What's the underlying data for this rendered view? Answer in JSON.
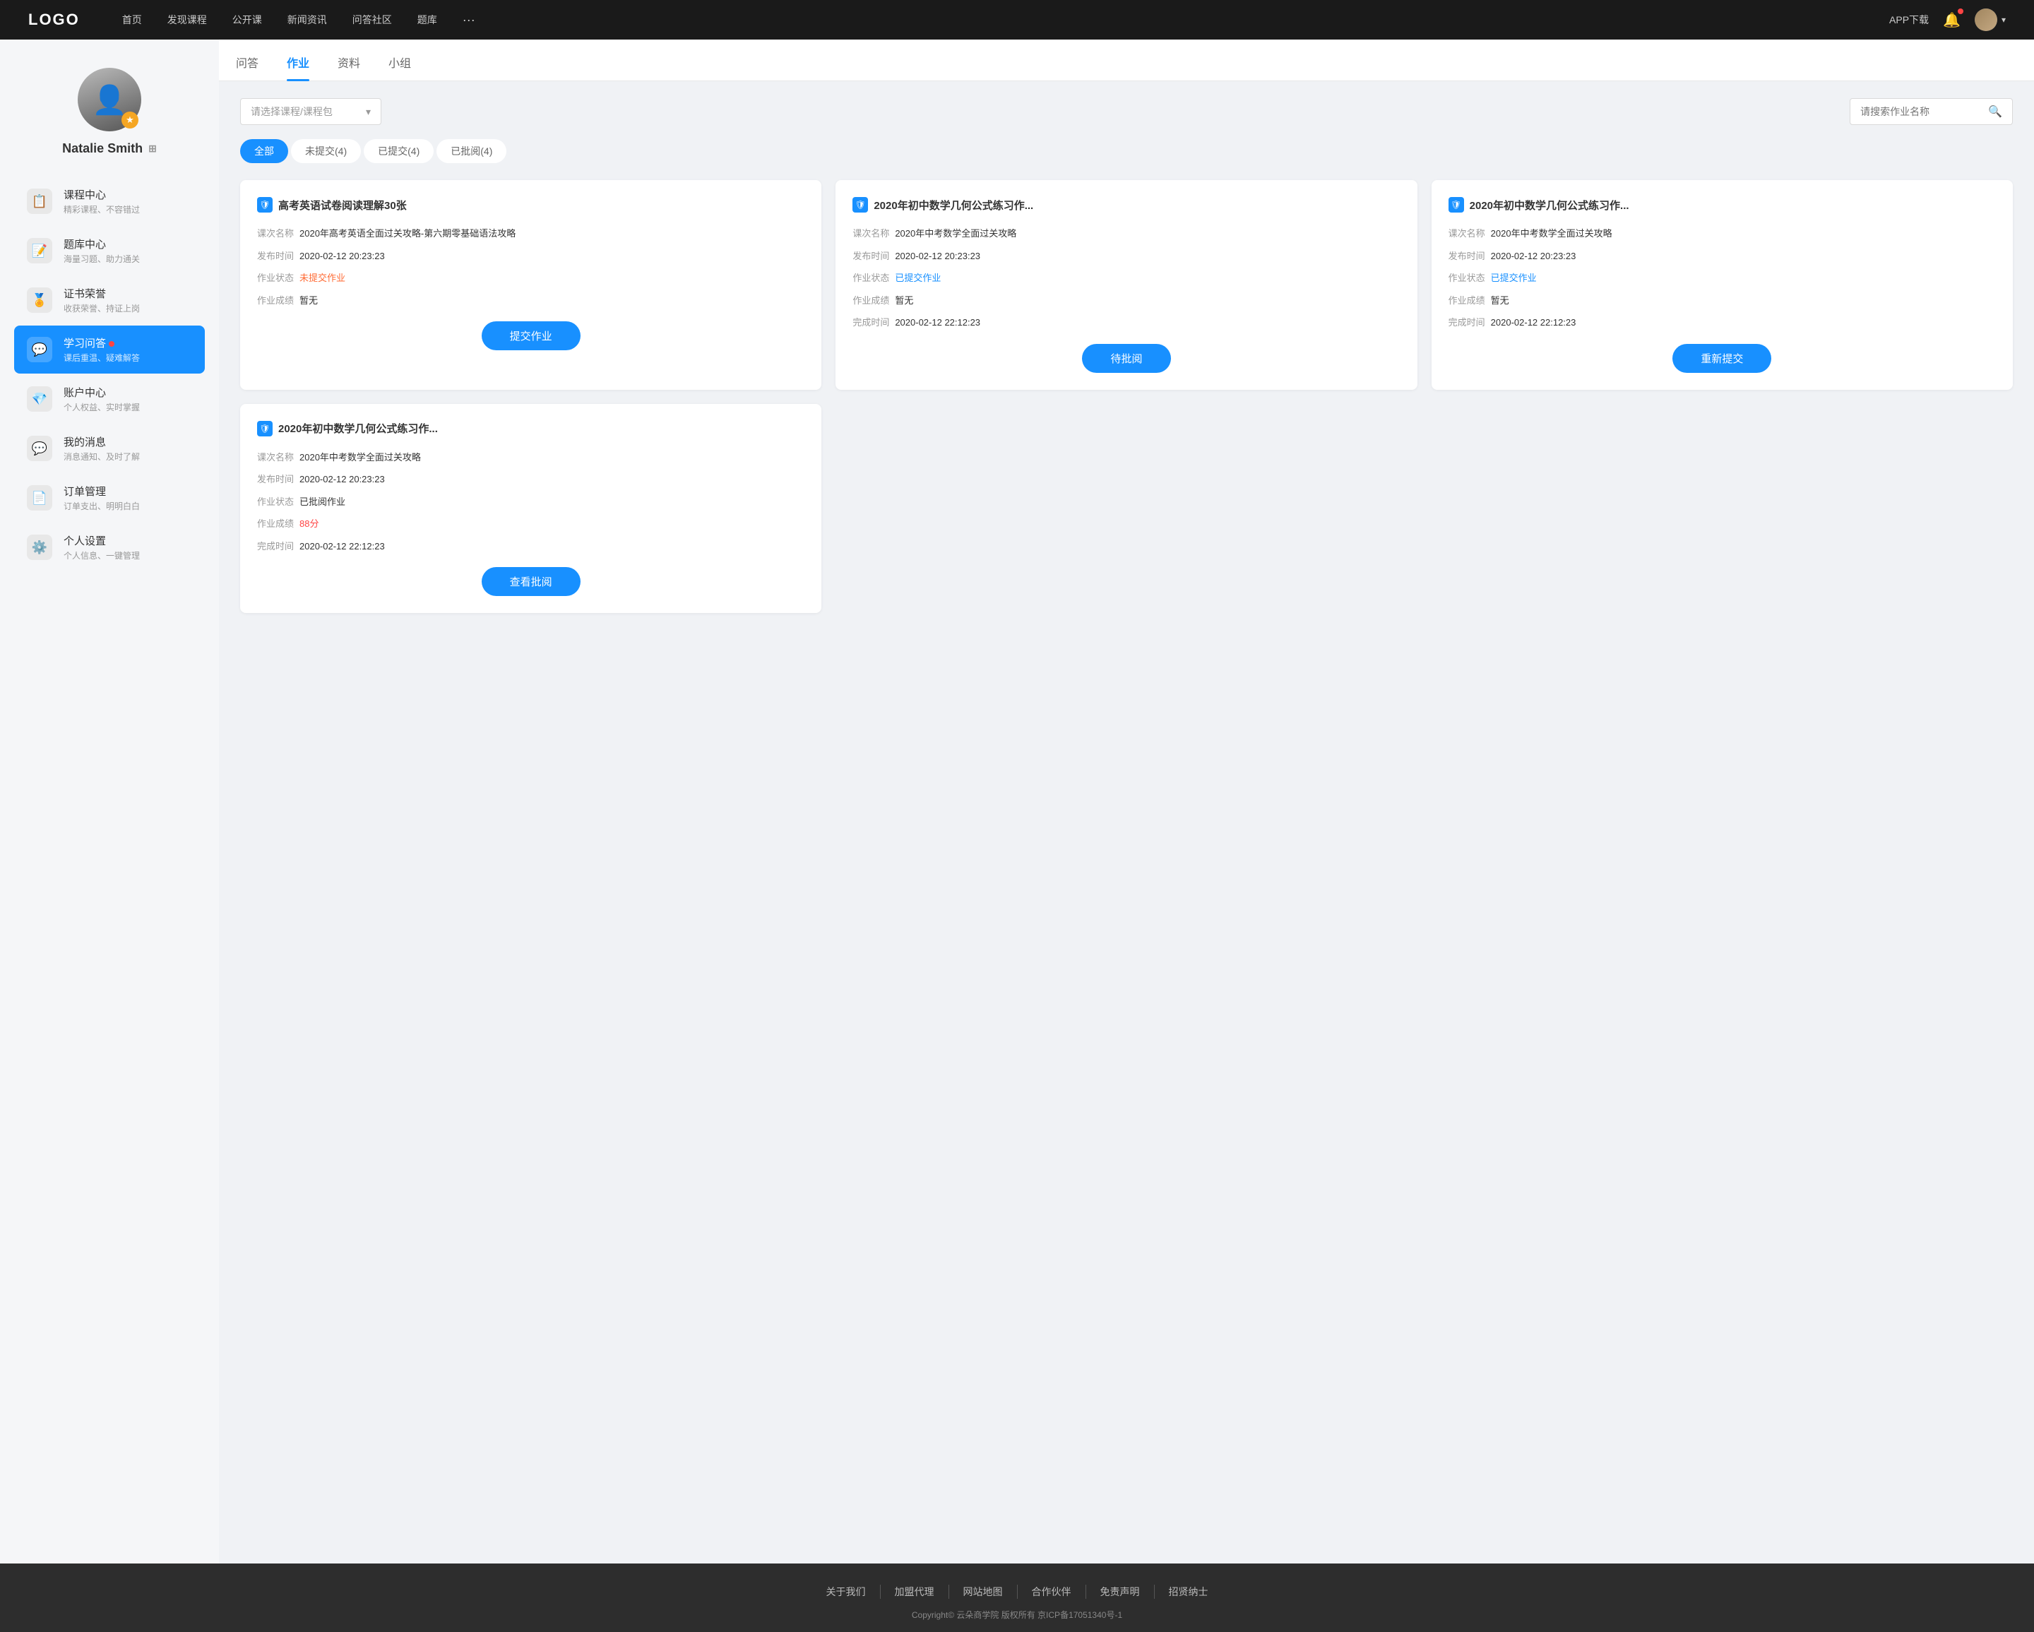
{
  "nav": {
    "logo": "LOGO",
    "links": [
      "首页",
      "发现课程",
      "公开课",
      "新闻资讯",
      "问答社区",
      "题库"
    ],
    "more": "···",
    "download": "APP下载"
  },
  "sidebar": {
    "username": "Natalie Smith",
    "items": [
      {
        "id": "course-center",
        "label": "课程中心",
        "sub": "精彩课程、不容错过",
        "icon": "📋",
        "active": false
      },
      {
        "id": "question-bank",
        "label": "题库中心",
        "sub": "海量习题、助力通关",
        "icon": "📝",
        "active": false
      },
      {
        "id": "certificate",
        "label": "证书荣誉",
        "sub": "收获荣誉、持证上岗",
        "icon": "🏅",
        "active": false
      },
      {
        "id": "study-qa",
        "label": "学习问答",
        "sub": "课后重温、疑难解答",
        "icon": "💬",
        "active": true,
        "badge": true
      },
      {
        "id": "account",
        "label": "账户中心",
        "sub": "个人权益、实时掌握",
        "icon": "💎",
        "active": false
      },
      {
        "id": "messages",
        "label": "我的消息",
        "sub": "消息通知、及时了解",
        "icon": "💬",
        "active": false
      },
      {
        "id": "orders",
        "label": "订单管理",
        "sub": "订单支出、明明白白",
        "icon": "📄",
        "active": false
      },
      {
        "id": "settings",
        "label": "个人设置",
        "sub": "个人信息、一键管理",
        "icon": "⚙️",
        "active": false
      }
    ]
  },
  "tabs": [
    "问答",
    "作业",
    "资料",
    "小组"
  ],
  "active_tab": "作业",
  "filter": {
    "course_placeholder": "请选择课程/课程包",
    "search_placeholder": "请搜索作业名称"
  },
  "status_buttons": [
    "全部",
    "未提交(4)",
    "已提交(4)",
    "已批阅(4)"
  ],
  "active_status": "全部",
  "cards": [
    {
      "title": "高考英语试卷阅读理解30张",
      "course_name": "2020年高考英语全面过关攻略-第六期零基础语法攻略",
      "publish_time": "2020-02-12 20:23:23",
      "status_label": "未提交作业",
      "status_type": "unsubmitted",
      "score": "暂无",
      "finish_time": "",
      "btn_label": "提交作业",
      "show_finish": false
    },
    {
      "title": "2020年初中数学几何公式练习作...",
      "course_name": "2020年中考数学全面过关攻略",
      "publish_time": "2020-02-12 20:23:23",
      "status_label": "已提交作业",
      "status_type": "submitted",
      "score": "暂无",
      "finish_time": "2020-02-12 22:12:23",
      "btn_label": "待批阅",
      "show_finish": true
    },
    {
      "title": "2020年初中数学几何公式练习作...",
      "course_name": "2020年中考数学全面过关攻略",
      "publish_time": "2020-02-12 20:23:23",
      "status_label": "已提交作业",
      "status_type": "submitted",
      "score": "暂无",
      "finish_time": "2020-02-12 22:12:23",
      "btn_label": "重新提交",
      "show_finish": true
    },
    {
      "title": "2020年初中数学几何公式练习作...",
      "course_name": "2020年中考数学全面过关攻略",
      "publish_time": "2020-02-12 20:23:23",
      "status_label": "已批阅作业",
      "status_type": "reviewed",
      "score": "88分",
      "score_type": "red",
      "finish_time": "2020-02-12 22:12:23",
      "btn_label": "查看批阅",
      "show_finish": true
    }
  ],
  "card_labels": {
    "course_name": "课次名称",
    "publish_time": "发布时间",
    "status": "作业状态",
    "score": "作业成绩",
    "finish_time": "完成时间"
  },
  "footer": {
    "links": [
      "关于我们",
      "加盟代理",
      "网站地图",
      "合作伙伴",
      "免责声明",
      "招贤纳士"
    ],
    "copyright": "Copyright© 云朵商学院  版权所有    京ICP备17051340号-1"
  }
}
